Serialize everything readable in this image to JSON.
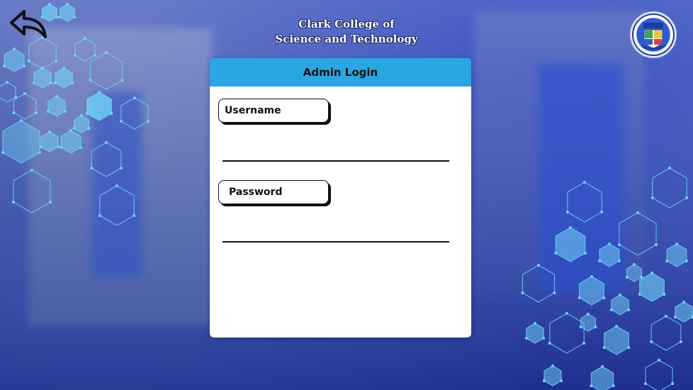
{
  "header": {
    "title_line1": "Clark College of",
    "title_line2": "Science and Technology"
  },
  "login": {
    "title": "Admin Login",
    "username_label": "Username",
    "username_value": "",
    "password_label": "Password",
    "password_value": ""
  },
  "icons": {
    "back": "back-arrow-icon",
    "logo": "college-seal-logo"
  },
  "colors": {
    "card_header": "#2aa7e2",
    "card_bg": "#ffffff",
    "background_primary": "#3347a6",
    "hexagon_accent": "#6fd3f7"
  }
}
